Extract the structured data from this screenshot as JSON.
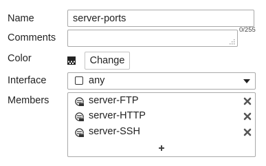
{
  "form": {
    "name_label": "Name",
    "name_value": "server-ports",
    "comments_label": "Comments",
    "comments_value": "",
    "comments_counter": "0/255",
    "color_label": "Color",
    "color_swatch_icon": "color-swatch-icon",
    "change_button": "Change",
    "interface_label": "Interface",
    "interface_value": "any",
    "members_label": "Members",
    "members": [
      {
        "label": "server-FTP",
        "icon": "service-icon"
      },
      {
        "label": "server-HTTP",
        "icon": "service-icon"
      },
      {
        "label": "server-SSH",
        "icon": "service-icon"
      }
    ],
    "add_member_icon": "plus-icon",
    "remove_member_icon": "close-x-icon"
  }
}
